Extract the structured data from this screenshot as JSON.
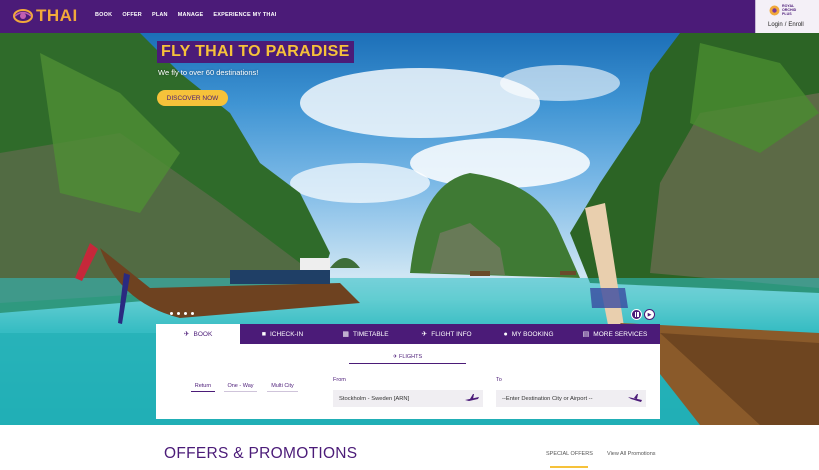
{
  "header": {
    "brand": "THAI",
    "nav": [
      "BOOK",
      "OFFER",
      "PLAN",
      "MANAGE",
      "EXPERIENCE MY THAI"
    ],
    "rop": {
      "line1": "ROYAL",
      "line2": "ORCHID",
      "line3": "PLUS",
      "login": "Login",
      "sep": "/",
      "enroll": "Enroll"
    }
  },
  "hero": {
    "title": "FLY THAI TO PARADISE",
    "subtitle": "We fly to over 60 destinations!",
    "cta": "DISCOVER NOW"
  },
  "booking": {
    "tabs": [
      {
        "label": "BOOK",
        "icon": "plane-icon"
      },
      {
        "label": "ICHECK-IN",
        "icon": "briefcase-icon"
      },
      {
        "label": "TIMETABLE",
        "icon": "calendar-icon"
      },
      {
        "label": "FLIGHT INFO",
        "icon": "plane-icon"
      },
      {
        "label": "MY BOOKING",
        "icon": "person-icon"
      },
      {
        "label": "MORE SERVICES",
        "icon": "document-icon"
      }
    ],
    "subtab": "FLIGHTS",
    "trip_types": [
      "Return",
      "One - Way",
      "Multi City"
    ],
    "from_label": "From",
    "from_value": "Stockholm - Sweden [ARN]",
    "to_label": "To",
    "to_placeholder": "--Enter Destination City or Airport  --"
  },
  "offers": {
    "title": "OFFERS & PROMOTIONS",
    "special": "SPECIAL OFFERS",
    "all": "View All Promotions"
  },
  "colors": {
    "brand_purple": "#4b1b78",
    "accent_gold": "#f6c23a"
  }
}
